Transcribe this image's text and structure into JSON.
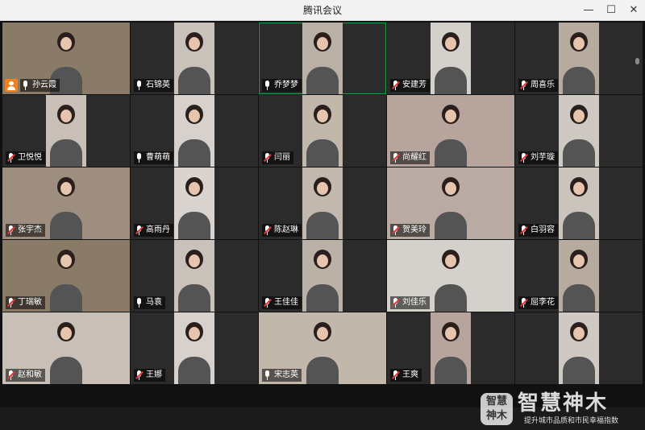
{
  "window": {
    "title": "腾讯会议",
    "minimize_glyph": "—",
    "maximize_glyph": "☐",
    "close_glyph": "✕"
  },
  "participants": [
    {
      "name": "孙云霞",
      "muted": false,
      "host": true,
      "video": "full",
      "active": false
    },
    {
      "name": "石锦英",
      "muted": false,
      "host": false,
      "video": "narrow",
      "active": false
    },
    {
      "name": "乔梦梦",
      "muted": false,
      "host": false,
      "video": "narrow",
      "active": true
    },
    {
      "name": "安建芳",
      "muted": true,
      "host": false,
      "video": "narrow",
      "active": false
    },
    {
      "name": "周喜乐",
      "muted": true,
      "host": false,
      "video": "narrow",
      "active": false
    },
    {
      "name": "卫悦悦",
      "muted": true,
      "host": false,
      "video": "narrow",
      "active": false
    },
    {
      "name": "曹萌萌",
      "muted": false,
      "host": false,
      "video": "narrow",
      "active": false
    },
    {
      "name": "闫丽",
      "muted": true,
      "host": false,
      "video": "narrow",
      "active": false
    },
    {
      "name": "尚耀红",
      "muted": true,
      "host": false,
      "video": "full",
      "active": false
    },
    {
      "name": "刘芋璇",
      "muted": true,
      "host": false,
      "video": "narrow",
      "active": false
    },
    {
      "name": "张宇杰",
      "muted": true,
      "host": false,
      "video": "full",
      "active": false
    },
    {
      "name": "高雨丹",
      "muted": true,
      "host": false,
      "video": "narrow",
      "active": false
    },
    {
      "name": "陈赵琳",
      "muted": true,
      "host": false,
      "video": "narrow",
      "active": false
    },
    {
      "name": "贺美玲",
      "muted": true,
      "host": false,
      "video": "full",
      "active": false
    },
    {
      "name": "白羽容",
      "muted": true,
      "host": false,
      "video": "narrow",
      "active": false
    },
    {
      "name": "丁瑞敏",
      "muted": true,
      "host": false,
      "video": "full",
      "active": false
    },
    {
      "name": "马袁",
      "muted": false,
      "host": false,
      "video": "narrow",
      "active": false
    },
    {
      "name": "王佳佳",
      "muted": true,
      "host": false,
      "video": "narrow",
      "active": false
    },
    {
      "name": "刘佳乐",
      "muted": true,
      "host": false,
      "video": "full",
      "active": false
    },
    {
      "name": "屈李花",
      "muted": true,
      "host": false,
      "video": "narrow",
      "active": false
    },
    {
      "name": "赵和敏",
      "muted": true,
      "host": false,
      "video": "full",
      "active": false
    },
    {
      "name": "王娜",
      "muted": true,
      "host": false,
      "video": "narrow",
      "active": false
    },
    {
      "name": "宋志英",
      "muted": false,
      "host": false,
      "video": "full",
      "active": false
    },
    {
      "name": "王爽",
      "muted": true,
      "host": false,
      "video": "narrow",
      "active": false
    },
    {
      "name": "",
      "muted": false,
      "host": false,
      "video": "narrow",
      "active": false
    }
  ],
  "video_colors": [
    "#8a7a68",
    "#c9c2bb",
    "#b9b1a6",
    "#d4d0cb",
    "#b7aba0",
    "#c8bfb7",
    "#d6d1cd",
    "#c1b7ab",
    "#b7a49c",
    "#cfc9c3",
    "#9e8e7f",
    "#d9d4cf",
    "#c2b8ae",
    "#b9aaa3",
    "#cbc4bd"
  ],
  "watermark": {
    "logo_text_line1": "智慧",
    "logo_text_line2": "神木",
    "brand": "智慧神木",
    "slogan": "提升城市品质和市民幸福指数"
  }
}
